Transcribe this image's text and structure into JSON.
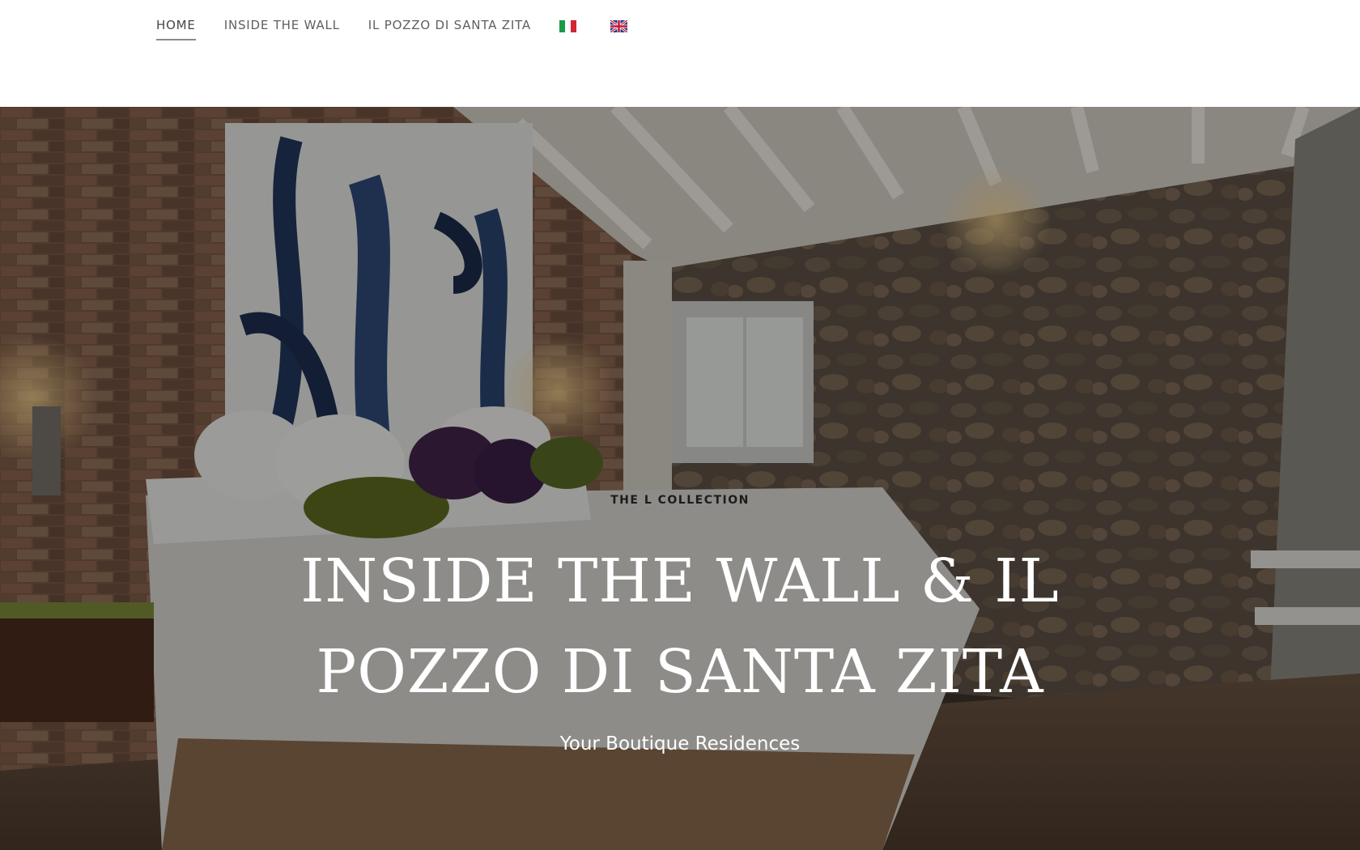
{
  "nav": {
    "items": [
      {
        "label": "HOME",
        "active": true
      },
      {
        "label": "INSIDE THE WALL",
        "active": false
      },
      {
        "label": "IL POZZO DI SANTA ZITA",
        "active": false
      }
    ],
    "languages": [
      {
        "icon": "italy-flag-icon"
      },
      {
        "icon": "uk-flag-icon"
      }
    ]
  },
  "hero": {
    "eyebrow": "THE L COLLECTION",
    "title": "INSIDE THE WALL & IL POZZO DI SANTA ZITA",
    "subtitle": "Your Boutique Residences"
  },
  "colors": {
    "header_bg": "#ffffff",
    "nav_text": "#5f5f5f",
    "hero_text": "#ffffff"
  }
}
